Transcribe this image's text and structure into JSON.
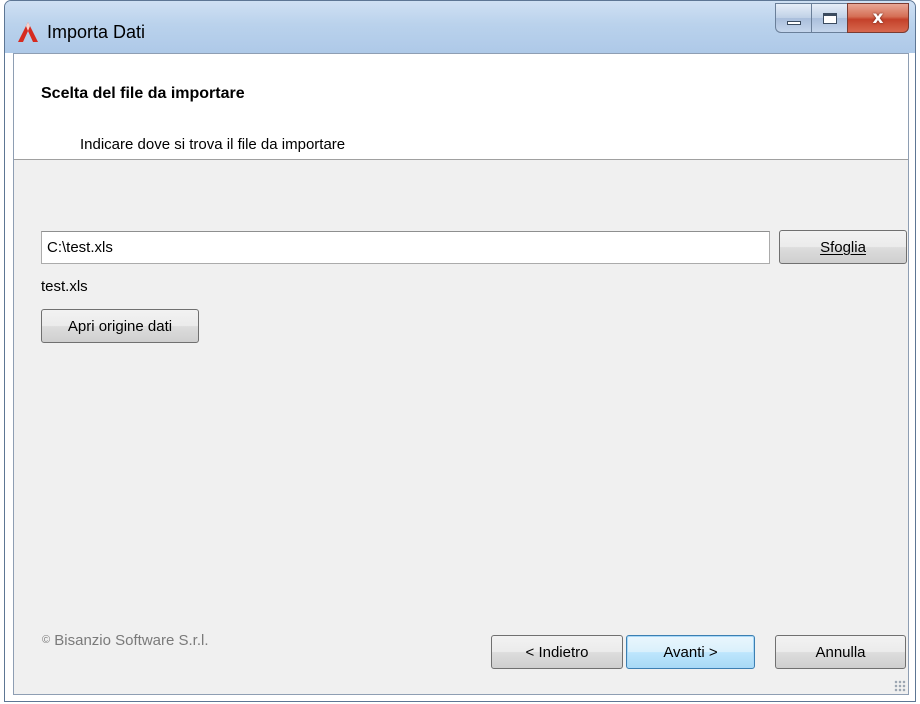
{
  "window": {
    "title": "Importa Dati",
    "close_glyph": "x"
  },
  "header": {
    "title": "Scelta del file da importare",
    "subtitle": "Indicare dove si trova il file da importare"
  },
  "file": {
    "path_value": "C:\\test.xls",
    "browse_label": "Sfoglia",
    "name": "test.xls",
    "open_source_label": "Apri origine dati"
  },
  "footer": {
    "copyright_symbol": "©",
    "copyright": "Bisanzio Software S.r.l.",
    "back_label": "< Indietro",
    "next_label": "Avanti >",
    "cancel_label": "Annulla"
  },
  "colors": {
    "titlebar": "#bad2ec",
    "close_button": "#c4412a",
    "dialog_bg": "#f0f0f0",
    "app_icon": "#d62b20"
  }
}
